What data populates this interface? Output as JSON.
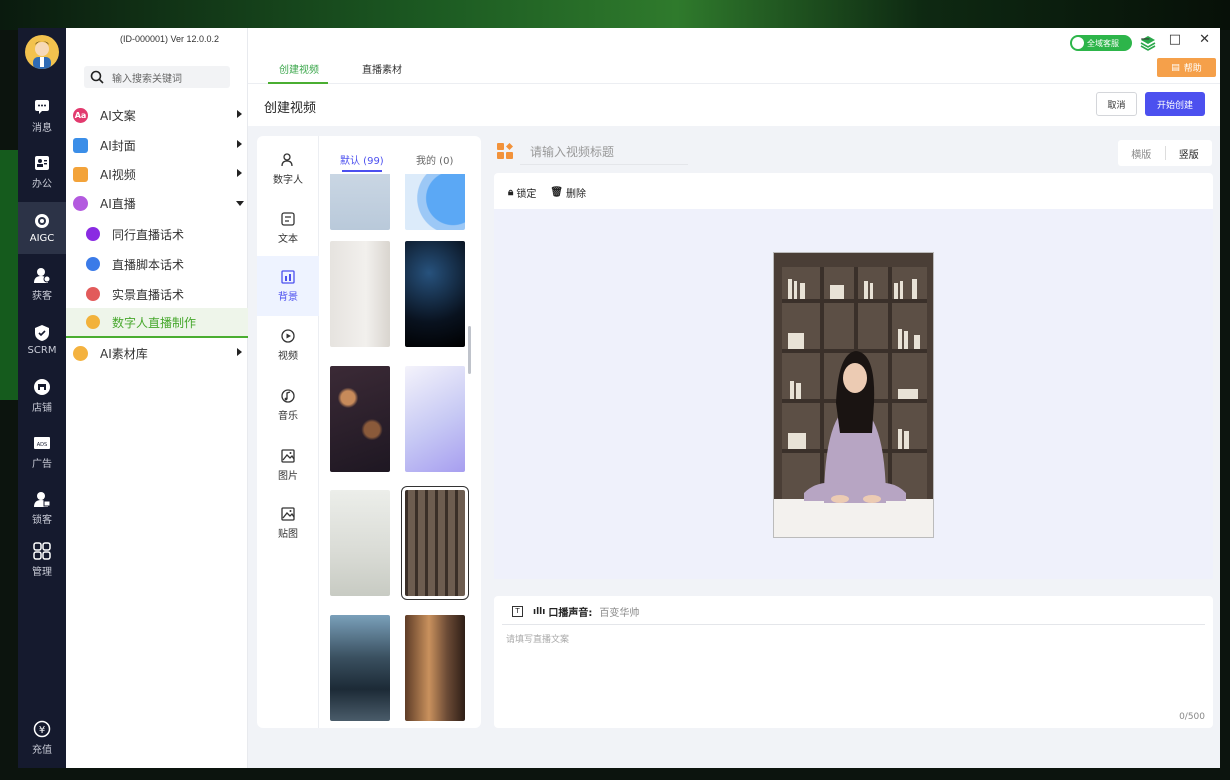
{
  "window": {
    "version": "(ID-000001)  Ver 12.0.0.2",
    "service_label": "全域客服"
  },
  "rail": {
    "items": [
      {
        "label": "消息"
      },
      {
        "label": "办公"
      },
      {
        "label": "AIGC"
      },
      {
        "label": "获客"
      },
      {
        "label": "SCRM"
      },
      {
        "label": "店铺"
      },
      {
        "label": "广告"
      },
      {
        "label": "锁客"
      },
      {
        "label": "管理"
      },
      {
        "label": "充值"
      }
    ]
  },
  "menu": {
    "search_placeholder": "输入搜索关键词",
    "items": [
      {
        "label": "AI文案"
      },
      {
        "label": "AI封面"
      },
      {
        "label": "AI视频"
      },
      {
        "label": "AI直播"
      },
      {
        "label": "同行直播话术"
      },
      {
        "label": "直播脚本话术"
      },
      {
        "label": "实景直播话术"
      },
      {
        "label": "数字人直播制作"
      },
      {
        "label": "AI素材库"
      }
    ]
  },
  "tabs": {
    "create_video": "创建视频",
    "live_material": "直播素材",
    "help": "帮助"
  },
  "header": {
    "title": "创建视频",
    "cancel": "取消",
    "start": "开始创建"
  },
  "categories": [
    {
      "label": "数字人"
    },
    {
      "label": "文本"
    },
    {
      "label": "背景"
    },
    {
      "label": "视频"
    },
    {
      "label": "音乐"
    },
    {
      "label": "图片"
    },
    {
      "label": "贴图"
    }
  ],
  "subtabs": {
    "default": "默认 (99)",
    "mine": "我的 (0)"
  },
  "editor": {
    "title_placeholder": "请输入视频标题",
    "orient_landscape": "横版",
    "orient_portrait": "竖版",
    "lock": "锁定",
    "delete": "删除",
    "voice_label": "口播声音:",
    "voice_value": "百变华帅",
    "script_placeholder": "请填写直播文案",
    "counter": "0/500"
  },
  "colors": {
    "accent_green": "#4aae31",
    "accent_blue": "#4c50ef",
    "rail_bg": "#151a2e",
    "help_orange": "#f5a04a"
  }
}
